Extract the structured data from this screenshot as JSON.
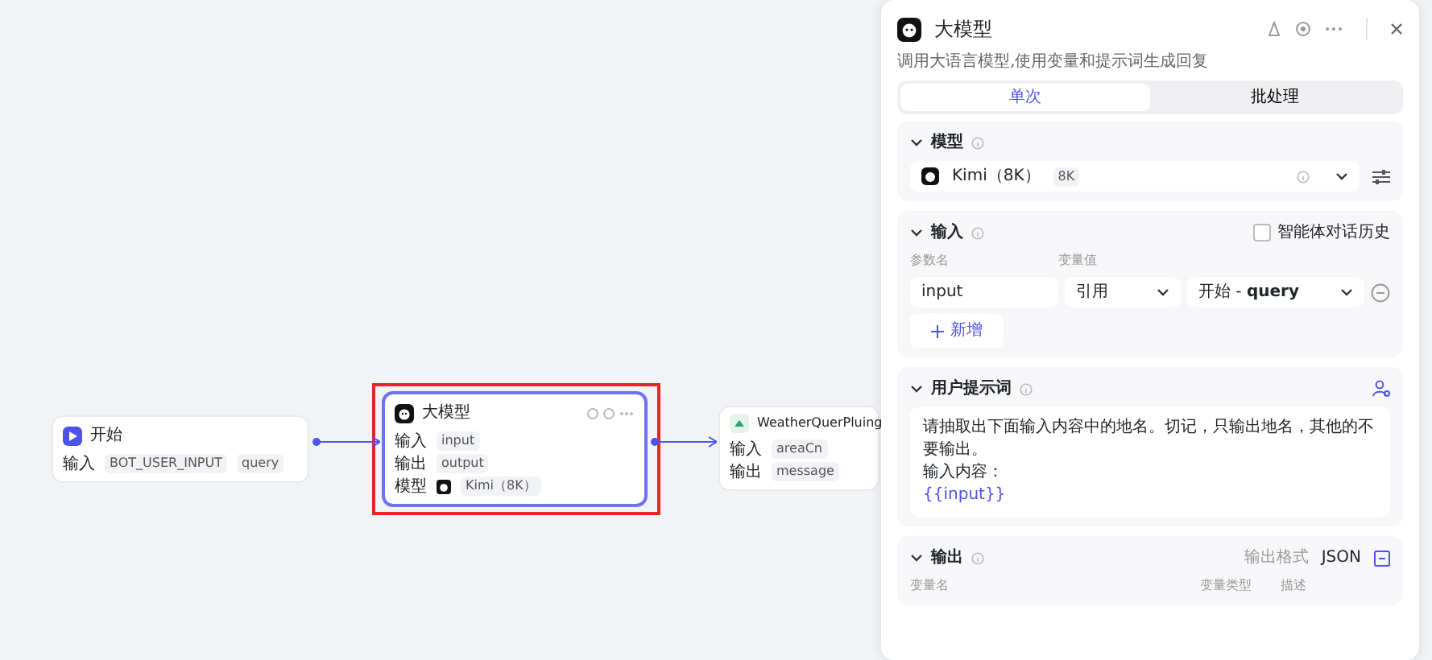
{
  "canvas": {
    "nodes": [
      {
        "kind": "start",
        "title": "开始",
        "selected": false,
        "rows": [
          {
            "label": "输入",
            "tags": [
              "BOT_USER_INPUT",
              "query"
            ]
          }
        ]
      },
      {
        "kind": "llm",
        "title": "大模型",
        "selected": true,
        "rows": [
          {
            "label": "输入",
            "tags": [
              "input"
            ]
          },
          {
            "label": "输出",
            "tags": [
              "output"
            ]
          },
          {
            "label": "模型",
            "model": "Kimi（8K）"
          }
        ]
      },
      {
        "kind": "plugin",
        "title": "WeatherQuerPluing",
        "selected": false,
        "rows": [
          {
            "label": "输入",
            "tags": [
              "areaCn"
            ]
          },
          {
            "label": "输出",
            "tags": [
              "message"
            ]
          }
        ]
      }
    ]
  },
  "panel": {
    "title": "大模型",
    "description": "调用大语言模型,使用变量和提示词生成回复",
    "tabs": [
      {
        "label": "单次",
        "selected": true
      },
      {
        "label": "批处理",
        "selected": false
      }
    ],
    "model_section": {
      "title": "模型",
      "model": "Kimi（8K）",
      "badge": "8K"
    },
    "input_section": {
      "title": "输入",
      "history_label": "智能体对话历史",
      "history_checked": false,
      "columns": [
        "参数名",
        "变量值"
      ],
      "params": [
        {
          "name": "input",
          "source": "引用",
          "value": "开始 - **query**"
        }
      ],
      "add_label": "新增"
    },
    "prompt_section": {
      "title": "用户提示词",
      "lines": [
        {
          "kind": "text",
          "text": "请抽取出下面输入内容中的地名。切记，只输出地名，其他的不要输出。"
        },
        {
          "kind": "text",
          "text": "输入内容："
        },
        {
          "kind": "variable",
          "text": "{{input}}"
        }
      ]
    },
    "output_section": {
      "title": "输出",
      "format_label": "输出格式",
      "format": "JSON",
      "columns": [
        "变量名",
        "变量类型",
        "描述"
      ]
    }
  }
}
